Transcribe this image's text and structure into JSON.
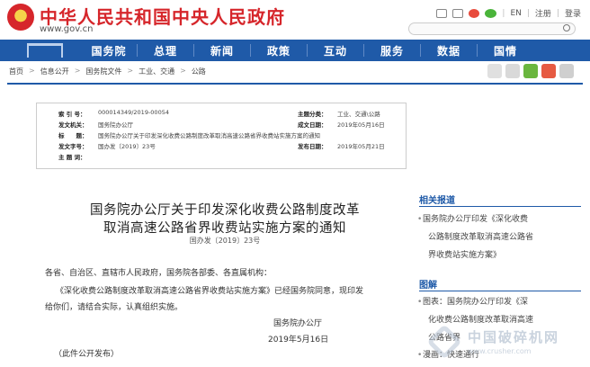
{
  "header": {
    "title": "中华人民共和国中央人民政府",
    "url": "www.gov.cn",
    "links": [
      "EN",
      "注册",
      "登录"
    ]
  },
  "nav": {
    "items": [
      "国务院",
      "总理",
      "新闻",
      "政策",
      "互动",
      "服务",
      "数据",
      "国情"
    ]
  },
  "breadcrumb": [
    "首页",
    "信息公开",
    "国务院文件",
    "工业、交通",
    "公路"
  ],
  "meta": {
    "index_key": "索 引 号：",
    "index_val": "000014349/2019-00054",
    "category_key": "主题分类：",
    "category_val": "工业、交通\\公路",
    "issuer_key": "发文机关：",
    "issuer_val": "国务院办公厅",
    "date_key": "成文日期：",
    "date_val": "2019年05月16日",
    "title_key": "标　　题：",
    "title_val": "国务院办公厅关于印发深化收费公路制度改革取消高速公路省界收费站实施方案的通知",
    "docno_key": "发文字号：",
    "docno_val": "国办发〔2019〕23号",
    "pub_key": "发布日期：",
    "pub_val": "2019年05月21日",
    "subject_key": "主 题 词："
  },
  "article": {
    "title_line1": "国务院办公厅关于印发深化收费公路制度改革",
    "title_line2": "取消高速公路省界收费站实施方案的通知",
    "doc_no": "国办发〔2019〕23号",
    "para1": "各省、自治区、直辖市人民政府，国务院各部委、各直属机构：",
    "para2": "《深化收费公路制度改革取消高速公路省界收费站实施方案》已经国务院同意，现印发",
    "para3": "给你们，请结合实际，认真组织实施。",
    "sign_org": "国务院办公厅",
    "sign_date": "2019年5月16日",
    "note": "（此件公开发布）"
  },
  "sidebar": {
    "related_title": "相关报道",
    "related_lines": [
      "国务院办公厅印发《深化收费",
      "公路制度改革取消高速公路省",
      "界收费站实施方案》"
    ],
    "diagram_title": "图解",
    "diagram_lines": [
      "图表：国务院办公厅印发《深",
      "化收费公路制度改革取消高速",
      "公路省界"
    ],
    "bottom_line": "漫画：快速通行"
  },
  "watermark": {
    "text": "中国破碎机网",
    "url": "www.crusher.com"
  }
}
